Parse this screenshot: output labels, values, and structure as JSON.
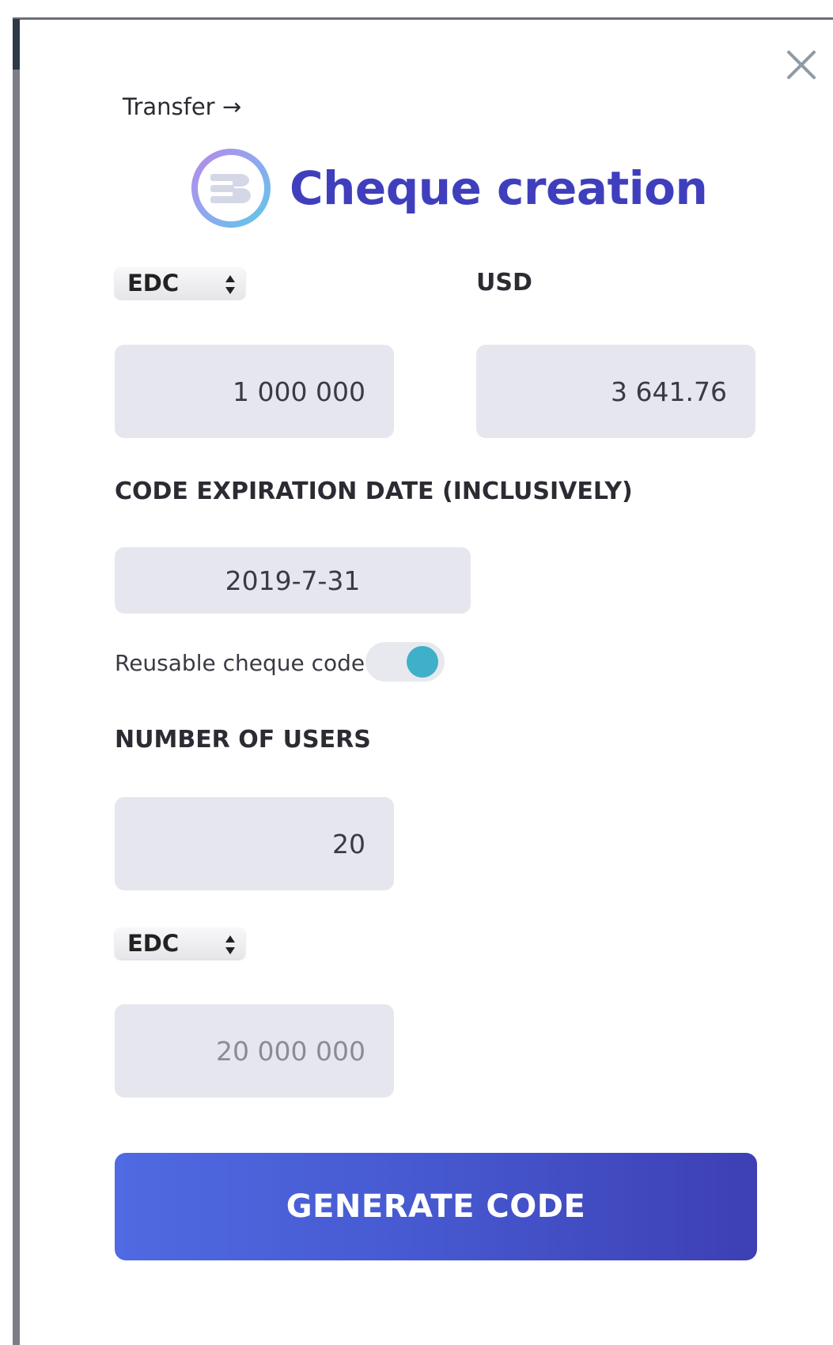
{
  "header": {
    "transfer_link": "Transfer →",
    "title": "Cheque creation",
    "close_icon": "close-icon",
    "logo_icon": "eb-logo-icon"
  },
  "amount": {
    "currency_select": "EDC",
    "converted_currency": "USD",
    "amount_value": "1 000 000",
    "converted_value": "3 641.76"
  },
  "expiration": {
    "label": "CODE EXPIRATION DATE (INCLUSIVELY)",
    "date_value": "2019-7-31"
  },
  "reusable": {
    "label": "Reusable cheque code",
    "enabled": true
  },
  "users": {
    "label": "NUMBER OF USERS",
    "count_value": "20",
    "total_currency_select": "EDC",
    "total_value": "20 000 000"
  },
  "actions": {
    "generate_label": "GENERATE CODE"
  },
  "colors": {
    "accent": "#3f3fbd",
    "toggle_on": "#3fb0c9",
    "button_start": "#4f6ae2",
    "button_end": "#3e3fb4",
    "field_bg": "#e6e7ee"
  }
}
